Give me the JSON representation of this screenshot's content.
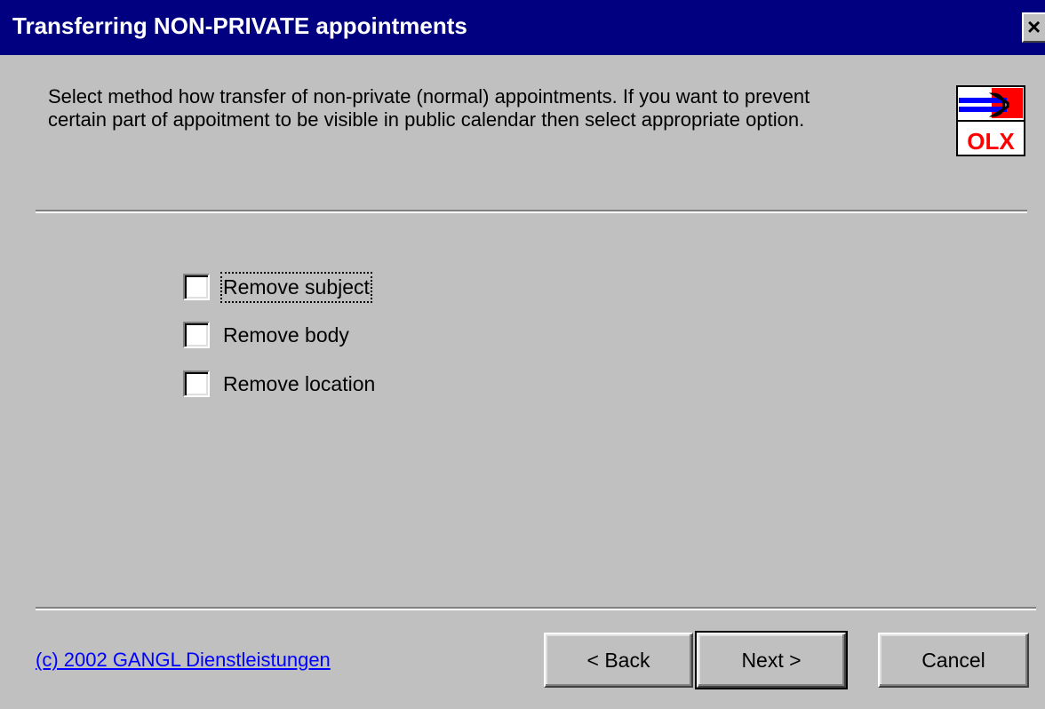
{
  "window": {
    "title": "Transferring NON-PRIVATE appointments",
    "close_glyph": "✕"
  },
  "description": {
    "line1": "Select method how transfer of non-private (normal) appointments. If you want to prevent",
    "line2": "certain part of appoitment to be visible in public calendar then select appropriate option."
  },
  "app_icon": {
    "icon": "olx-logo-icon",
    "text": "OLX"
  },
  "options": [
    {
      "label": "Remove subject",
      "checked": false,
      "focused": true
    },
    {
      "label": "Remove body",
      "checked": false,
      "focused": false
    },
    {
      "label": "Remove location",
      "checked": false,
      "focused": false
    }
  ],
  "footer": {
    "copyright": "(c) 2002 GANGL Dienstleistungen",
    "back_label": "< Back",
    "next_label": "Next >",
    "cancel_label": "Cancel"
  },
  "colors": {
    "titlebar": "#000080",
    "face": "#c0c0c0",
    "link": "#0000ff",
    "icon_red": "#ff0000"
  }
}
